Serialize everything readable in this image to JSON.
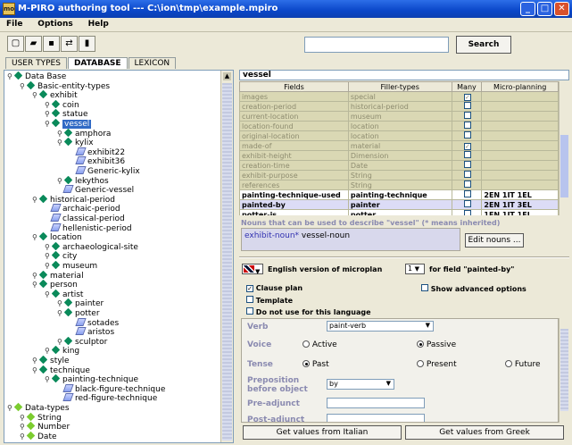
{
  "window": {
    "title": "M-PIRO authoring tool --- C:\\ion\\tmp\\example.mpiro",
    "app_icon_text": "mo"
  },
  "menu": [
    "File",
    "Options",
    "Help"
  ],
  "toolbar": {
    "search_label": "Search",
    "search_value": ""
  },
  "tabs": [
    "USER TYPES",
    "DATABASE",
    "LEXICON"
  ],
  "tree": [
    {
      "label": "Data Base",
      "depth": 0,
      "icon": "folder"
    },
    {
      "label": "Basic-entity-types",
      "depth": 1,
      "icon": "folder"
    },
    {
      "label": "exhibit",
      "depth": 2,
      "icon": "folder"
    },
    {
      "label": "coin",
      "depth": 3,
      "icon": "folder"
    },
    {
      "label": "statue",
      "depth": 3,
      "icon": "folder"
    },
    {
      "label": "vessel",
      "depth": 3,
      "icon": "folder",
      "selected": true
    },
    {
      "label": "amphora",
      "depth": 4,
      "icon": "folder"
    },
    {
      "label": "kylix",
      "depth": 4,
      "icon": "folder"
    },
    {
      "label": "exhibit22",
      "depth": 5,
      "icon": "leaf"
    },
    {
      "label": "exhibit36",
      "depth": 5,
      "icon": "leaf"
    },
    {
      "label": "Generic-kylix",
      "depth": 5,
      "icon": "leaf"
    },
    {
      "label": "lekythos",
      "depth": 4,
      "icon": "folder"
    },
    {
      "label": "Generic-vessel",
      "depth": 4,
      "icon": "leaf"
    },
    {
      "label": "historical-period",
      "depth": 2,
      "icon": "folder"
    },
    {
      "label": "archaic-period",
      "depth": 3,
      "icon": "leaf"
    },
    {
      "label": "classical-period",
      "depth": 3,
      "icon": "leaf"
    },
    {
      "label": "hellenistic-period",
      "depth": 3,
      "icon": "leaf"
    },
    {
      "label": "location",
      "depth": 2,
      "icon": "folder"
    },
    {
      "label": "archaeological-site",
      "depth": 3,
      "icon": "folder"
    },
    {
      "label": "city",
      "depth": 3,
      "icon": "folder"
    },
    {
      "label": "museum",
      "depth": 3,
      "icon": "folder"
    },
    {
      "label": "material",
      "depth": 2,
      "icon": "folder"
    },
    {
      "label": "person",
      "depth": 2,
      "icon": "folder"
    },
    {
      "label": "artist",
      "depth": 3,
      "icon": "folder"
    },
    {
      "label": "painter",
      "depth": 4,
      "icon": "folder"
    },
    {
      "label": "potter",
      "depth": 4,
      "icon": "folder"
    },
    {
      "label": "sotades",
      "depth": 5,
      "icon": "leaf"
    },
    {
      "label": "aristos",
      "depth": 5,
      "icon": "leaf"
    },
    {
      "label": "sculptor",
      "depth": 4,
      "icon": "folder"
    },
    {
      "label": "king",
      "depth": 3,
      "icon": "folder"
    },
    {
      "label": "style",
      "depth": 2,
      "icon": "folder"
    },
    {
      "label": "technique",
      "depth": 2,
      "icon": "folder"
    },
    {
      "label": "painting-technique",
      "depth": 3,
      "icon": "folder"
    },
    {
      "label": "black-figure-technique",
      "depth": 4,
      "icon": "leaf"
    },
    {
      "label": "red-figure-technique",
      "depth": 4,
      "icon": "leaf"
    },
    {
      "label": "Data-types",
      "depth": 0,
      "icon": "green"
    },
    {
      "label": "String",
      "depth": 1,
      "icon": "green"
    },
    {
      "label": "Number",
      "depth": 1,
      "icon": "green"
    },
    {
      "label": "Date",
      "depth": 1,
      "icon": "green"
    }
  ],
  "fields_panel": {
    "title": "vessel",
    "columns": [
      "Fields",
      "Filler-types",
      "Many",
      "Micro-planning"
    ],
    "rows": [
      {
        "field": "images",
        "filler": "special",
        "many": true,
        "micro": "",
        "kind": "inherited"
      },
      {
        "field": "creation-period",
        "filler": "historical-period",
        "many": false,
        "micro": "",
        "kind": "inherited"
      },
      {
        "field": "current-location",
        "filler": "museum",
        "many": false,
        "micro": "",
        "kind": "inherited"
      },
      {
        "field": "location-found",
        "filler": "location",
        "many": false,
        "micro": "",
        "kind": "inherited"
      },
      {
        "field": "original-location",
        "filler": "location",
        "many": false,
        "micro": "",
        "kind": "inherited"
      },
      {
        "field": "made-of",
        "filler": "material",
        "many": true,
        "micro": "",
        "kind": "inherited"
      },
      {
        "field": "exhibit-height",
        "filler": "Dimension",
        "many": false,
        "micro": "",
        "kind": "inherited"
      },
      {
        "field": "creation-time",
        "filler": "Date",
        "many": false,
        "micro": "",
        "kind": "inherited"
      },
      {
        "field": "exhibit-purpose",
        "filler": "String",
        "many": false,
        "micro": "",
        "kind": "inherited"
      },
      {
        "field": "references",
        "filler": "String",
        "many": false,
        "micro": "",
        "kind": "inherited"
      },
      {
        "field": "painting-technique-used",
        "filler": "painting-technique",
        "many": false,
        "micro": "2EN  1IT  1EL",
        "kind": "own"
      },
      {
        "field": "painted-by",
        "filler": "painter",
        "many": false,
        "micro": "2EN  1IT  3EL",
        "kind": "selected"
      },
      {
        "field": "potter-is",
        "filler": "potter",
        "many": false,
        "micro": "1EN  1IT  1EL",
        "kind": "own"
      }
    ]
  },
  "nouns": {
    "caption": "Nouns that can be used to describe  \"vessel\" (* means inherited)",
    "inherited_noun": "exhibit-noun*",
    "own_noun": "vessel-noun",
    "edit_label": "Edit nouns ..."
  },
  "microplan": {
    "language_prefix": "English version of microplan",
    "number": "1",
    "field_suffix": "for field \"painted-by\"",
    "clause_plan": "Clause plan",
    "clause_plan_checked": true,
    "show_advanced": "Show advanced options",
    "template": "Template",
    "do_not_use": "Do not use for this language",
    "verb_label": "Verb",
    "verb_value": "paint-verb",
    "voice_label": "Voice",
    "voice_options": [
      "Active",
      "Passive"
    ],
    "voice_selected": "Passive",
    "tense_label": "Tense",
    "tense_options": [
      "Past",
      "Present",
      "Future"
    ],
    "tense_selected": "Past",
    "preposition_label": "Preposition before object",
    "preposition_value": "by",
    "pre_adjunct_label": "Pre-adjunct",
    "post_adjunct_label": "Post-adjunct",
    "get_italian": "Get values from Italian",
    "get_greek": "Get values from Greek"
  },
  "colors": {
    "titlebar": "#0a46c8",
    "selection": "#316ac5",
    "inherited_row": "#dad8b4",
    "selected_row": "#dcdcf6"
  }
}
